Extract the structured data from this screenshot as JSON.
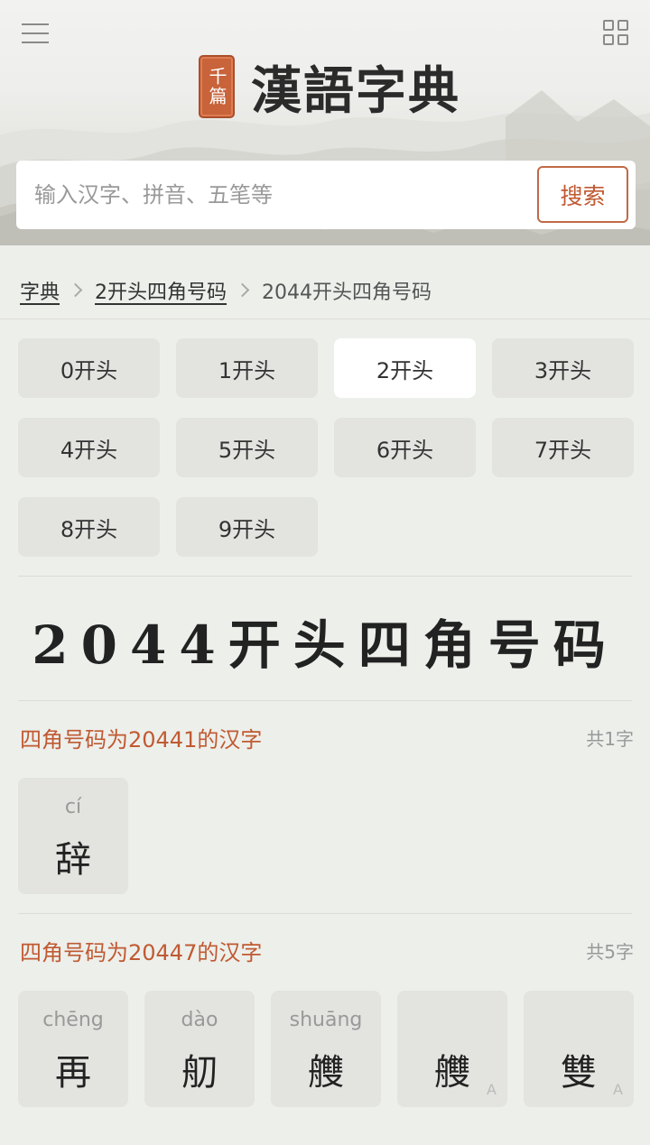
{
  "header": {
    "logo_seal": "千篇",
    "logo_text": "漢語字典",
    "search_placeholder": "输入汉字、拼音、五笔等",
    "search_button": "搜索"
  },
  "breadcrumb": {
    "items": [
      {
        "label": "字典",
        "link": true
      },
      {
        "label": "2开头四角号码",
        "link": true
      },
      {
        "label": "2044开头四角号码",
        "link": false
      }
    ]
  },
  "tabs": [
    {
      "label": "0开头",
      "active": false
    },
    {
      "label": "1开头",
      "active": false
    },
    {
      "label": "2开头",
      "active": true
    },
    {
      "label": "3开头",
      "active": false
    },
    {
      "label": "4开头",
      "active": false
    },
    {
      "label": "5开头",
      "active": false
    },
    {
      "label": "6开头",
      "active": false
    },
    {
      "label": "7开头",
      "active": false
    },
    {
      "label": "8开头",
      "active": false
    },
    {
      "label": "9开头",
      "active": false
    }
  ],
  "page_title": "2044开头四角号码",
  "sections": [
    {
      "title": "四角号码为20441的汉字",
      "count": "共1字",
      "chars": [
        {
          "pinyin": "cí",
          "hanzi": "辞",
          "badge": ""
        }
      ]
    },
    {
      "title": "四角号码为20447的汉字",
      "count": "共5字",
      "chars": [
        {
          "pinyin": "chēng",
          "hanzi": "再",
          "badge": ""
        },
        {
          "pinyin": "dào",
          "hanzi": "舠",
          "badge": ""
        },
        {
          "pinyin": "shuāng",
          "hanzi": "艭",
          "badge": ""
        },
        {
          "pinyin": "",
          "hanzi": "艭",
          "badge": "A"
        },
        {
          "pinyin": "",
          "hanzi": "雙",
          "badge": "A"
        }
      ]
    }
  ],
  "colors": {
    "accent": "#c05a32",
    "seal": "#c8633a",
    "background": "#edefeb",
    "card": "#e3e4e0"
  }
}
